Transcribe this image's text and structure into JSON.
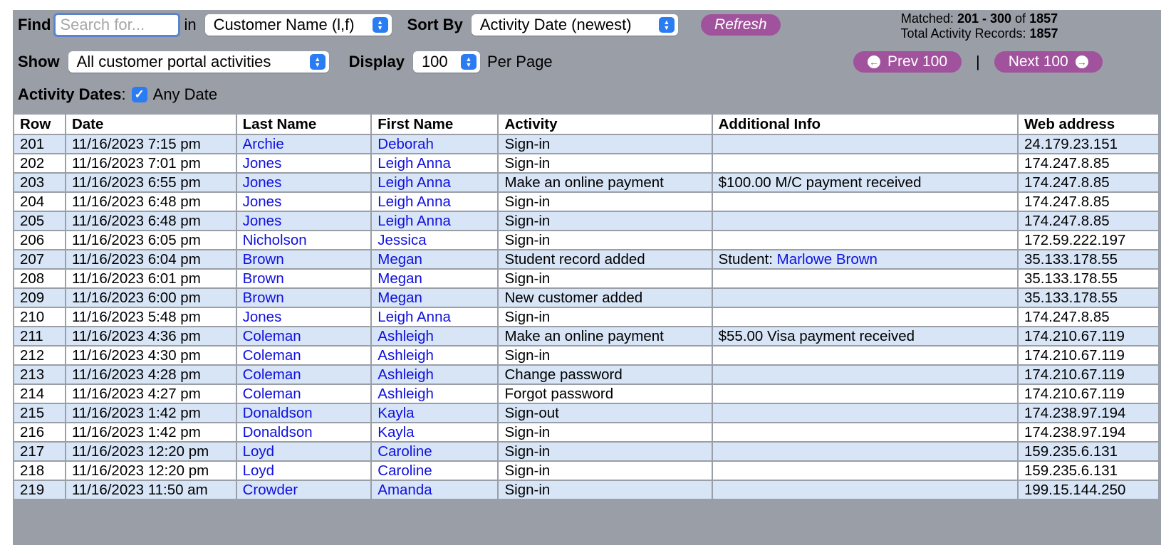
{
  "filters": {
    "find_label": "Find",
    "search_placeholder": "Search for...",
    "search_value": "",
    "in_label": "in",
    "search_field_selected": "Customer Name (l,f)",
    "sort_label": "Sort By",
    "sort_selected": "Activity Date (newest)",
    "refresh_label": "Refresh",
    "show_label": "Show",
    "show_selected": "All customer portal activities",
    "display_label": "Display",
    "display_selected": "100",
    "per_page_label": "Per Page",
    "activity_dates_label": "Activity Dates",
    "activity_dates_colon": ":",
    "any_date_label": "Any Date",
    "any_date_checked": true
  },
  "stats": {
    "matched_label": "Matched:",
    "matched_range": "201 - 300",
    "of_label": "of",
    "matched_total": "1857",
    "total_label": "Total Activity Records:",
    "total_records": "1857"
  },
  "pagination": {
    "prev_label": "Prev 100",
    "separator": "|",
    "next_label": "Next 100"
  },
  "colors": {
    "panel_bg": "#9a9ea6",
    "accent_purple": "#a0529c",
    "row_alt": "#d7e5f6",
    "link": "#1010e0"
  },
  "table": {
    "columns": [
      "Row",
      "Date",
      "Last Name",
      "First Name",
      "Activity",
      "Additional Info",
      "Web address"
    ],
    "rows": [
      {
        "row": "201",
        "date": "11/16/2023 7:15 pm",
        "last": "Archie",
        "first": "Deborah",
        "activity": "Sign-in",
        "info_prefix": "",
        "info_link": "",
        "ip": "24.179.23.151"
      },
      {
        "row": "202",
        "date": "11/16/2023 7:01 pm",
        "last": "Jones",
        "first": "Leigh Anna",
        "activity": "Sign-in",
        "info_prefix": "",
        "info_link": "",
        "ip": "174.247.8.85"
      },
      {
        "row": "203",
        "date": "11/16/2023 6:55 pm",
        "last": "Jones",
        "first": "Leigh Anna",
        "activity": "Make an online payment",
        "info_prefix": "$100.00 M/C payment received",
        "info_link": "",
        "ip": "174.247.8.85"
      },
      {
        "row": "204",
        "date": "11/16/2023 6:48 pm",
        "last": "Jones",
        "first": "Leigh Anna",
        "activity": "Sign-in",
        "info_prefix": "",
        "info_link": "",
        "ip": "174.247.8.85"
      },
      {
        "row": "205",
        "date": "11/16/2023 6:48 pm",
        "last": "Jones",
        "first": "Leigh Anna",
        "activity": "Sign-in",
        "info_prefix": "",
        "info_link": "",
        "ip": "174.247.8.85"
      },
      {
        "row": "206",
        "date": "11/16/2023 6:05 pm",
        "last": "Nicholson",
        "first": "Jessica",
        "activity": "Sign-in",
        "info_prefix": "",
        "info_link": "",
        "ip": "172.59.222.197"
      },
      {
        "row": "207",
        "date": "11/16/2023 6:04 pm",
        "last": "Brown",
        "first": "Megan",
        "activity": "Student record added",
        "info_prefix": "Student: ",
        "info_link": "Marlowe Brown",
        "ip": "35.133.178.55"
      },
      {
        "row": "208",
        "date": "11/16/2023 6:01 pm",
        "last": "Brown",
        "first": "Megan",
        "activity": "Sign-in",
        "info_prefix": "",
        "info_link": "",
        "ip": "35.133.178.55"
      },
      {
        "row": "209",
        "date": "11/16/2023 6:00 pm",
        "last": "Brown",
        "first": "Megan",
        "activity": "New customer added",
        "info_prefix": "",
        "info_link": "",
        "ip": "35.133.178.55"
      },
      {
        "row": "210",
        "date": "11/16/2023 5:48 pm",
        "last": "Jones",
        "first": "Leigh Anna",
        "activity": "Sign-in",
        "info_prefix": "",
        "info_link": "",
        "ip": "174.247.8.85"
      },
      {
        "row": "211",
        "date": "11/16/2023 4:36 pm",
        "last": "Coleman",
        "first": "Ashleigh",
        "activity": "Make an online payment",
        "info_prefix": "$55.00 Visa payment received",
        "info_link": "",
        "ip": "174.210.67.119"
      },
      {
        "row": "212",
        "date": "11/16/2023 4:30 pm",
        "last": "Coleman",
        "first": "Ashleigh",
        "activity": "Sign-in",
        "info_prefix": "",
        "info_link": "",
        "ip": "174.210.67.119"
      },
      {
        "row": "213",
        "date": "11/16/2023 4:28 pm",
        "last": "Coleman",
        "first": "Ashleigh",
        "activity": "Change password",
        "info_prefix": "",
        "info_link": "",
        "ip": "174.210.67.119"
      },
      {
        "row": "214",
        "date": "11/16/2023 4:27 pm",
        "last": "Coleman",
        "first": "Ashleigh",
        "activity": "Forgot password",
        "info_prefix": "",
        "info_link": "",
        "ip": "174.210.67.119"
      },
      {
        "row": "215",
        "date": "11/16/2023 1:42 pm",
        "last": "Donaldson",
        "first": "Kayla",
        "activity": "Sign-out",
        "info_prefix": "",
        "info_link": "",
        "ip": "174.238.97.194"
      },
      {
        "row": "216",
        "date": "11/16/2023 1:42 pm",
        "last": "Donaldson",
        "first": "Kayla",
        "activity": "Sign-in",
        "info_prefix": "",
        "info_link": "",
        "ip": "174.238.97.194"
      },
      {
        "row": "217",
        "date": "11/16/2023 12:20 pm",
        "last": "Loyd",
        "first": "Caroline",
        "activity": "Sign-in",
        "info_prefix": "",
        "info_link": "",
        "ip": "159.235.6.131"
      },
      {
        "row": "218",
        "date": "11/16/2023 12:20 pm",
        "last": "Loyd",
        "first": "Caroline",
        "activity": "Sign-in",
        "info_prefix": "",
        "info_link": "",
        "ip": "159.235.6.131"
      },
      {
        "row": "219",
        "date": "11/16/2023 11:50 am",
        "last": "Crowder",
        "first": "Amanda",
        "activity": "Sign-in",
        "info_prefix": "",
        "info_link": "",
        "ip": "199.15.144.250"
      }
    ]
  }
}
